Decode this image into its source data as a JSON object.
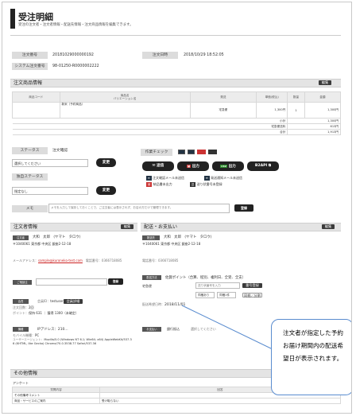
{
  "page": {
    "title": "受注明細",
    "subtitle": "受注の注文者・注文者情報・配送先情報・注文商品情報を編集できます。"
  },
  "summary": {
    "order_no_label": "注文番号",
    "order_no": "20181029000000192",
    "date_label": "注文日時",
    "date": "2018/10/29 18:52:05",
    "sys_no_label": "システム注文番号",
    "sys_no": "98-01250-R0000002222"
  },
  "items": {
    "heading": "注文商品情報",
    "edit": "編集",
    "col_code": "商品コード",
    "col_name": "商品名\nバリエーション名",
    "col_ship": "発送",
    "col_price": "単価(税込)",
    "col_qty": "数量",
    "col_total": "金額",
    "row": {
      "name": "新米（予約商品）",
      "ship": "宅急便",
      "price": "1,300円",
      "qty": "1",
      "total": "1,300円"
    },
    "subtotal_label": "小計",
    "subtotal": "1,300円",
    "shipfee_label": "宅急便送料",
    "shipfee": "613円",
    "grand_label": "合計",
    "grand": "1,913円"
  },
  "status": {
    "label": "ステータス",
    "current": "注文確認",
    "select": "選択してください",
    "change": "変更"
  },
  "custom_status": {
    "label": "独自ステータス",
    "select": "指定なし",
    "change": "変更"
  },
  "memo": {
    "label": "メモ",
    "placeholder": "メモを入力して保存しておくことで、ご注文者には表示されず、お店の方だけで管理できます。",
    "save": "登録"
  },
  "operations": {
    "label": "作業チェック",
    "mail_label": "送信",
    "print_label": "出力",
    "csv_label": "出力",
    "b2api": "B2API",
    "lines": [
      "注文確認メール未送信",
      "発送通知メール未送信",
      "納品書未出力",
      "送り状番号未登録"
    ]
  },
  "orderer": {
    "heading": "注文者情報",
    "edit": "編集",
    "tag": "注文者",
    "name": "大和　太郎　(ヤマト　タロウ)",
    "zip": "〒1040061",
    "address": "東京都 中央区 銀座2-12-18",
    "email_label": "メールアドレス：",
    "email": "sample@kuroneko-test.com",
    "phone_label": "電話番号：",
    "phone": "0366718085"
  },
  "related": {
    "label": "ご相談注",
    "save": "登録"
  },
  "member": {
    "tag": "会員",
    "member_label": "会員ID：",
    "member_id": "testuser",
    "detail_btn": "会員詳細",
    "orders_label": "注文回数：",
    "orders": "2回",
    "points_label": "ポイント：",
    "points": "保持 631 ｜ 獲得 1300（未確定）"
  },
  "device": {
    "tag": "機種",
    "value": "IPアドレス：210…",
    "mobile_label": "モバイル機種：",
    "mobile": "PC",
    "ua_label": "ユーザーエージェント：",
    "ua": "Mozilla/5.0 (Windows NT 6.1; Win64; x64) AppleWebKit/537.36 (KHTML, like Gecko) Chrome/70.0.3538.77 Safari/537.36"
  },
  "shipping": {
    "heading": "配送・お支払い",
    "edit": "編集",
    "tag": "配送先",
    "name": "大和　太郎　(ヤマト　タロウ)",
    "zip": "〒1040061",
    "address": "東京都 中央区 銀座2-12-18",
    "phone_label": "電話番号：",
    "phone": "0366718085",
    "method_tag": "配送方法",
    "method": "佐賀ポイント（合算、程別、複利日、全受、全支）",
    "carrier": "宅急便",
    "tracking_placeholder": "送り状番号を入力",
    "tracking_btn": "番号登録",
    "ship1": "同梱あり",
    "ship2": "同梱1件",
    "ship_btn": "同梱／分割",
    "desired_label": "配送希望日時：",
    "desired": "2018/11/01"
  },
  "payment": {
    "tag": "お支払い",
    "method": "銀行振込",
    "select": "選択してください"
  },
  "other": {
    "heading": "その他情報",
    "survey": "アンケート",
    "col_item": "質問内容",
    "col_answer": "回答",
    "row1": "その他備考コメント",
    "row2": "商品・サービスのご案内",
    "row2_answer": "受け取らない"
  },
  "callout": {
    "text": "注文者が指定した予約お届け期間内の配送希望日が表示されます。"
  }
}
